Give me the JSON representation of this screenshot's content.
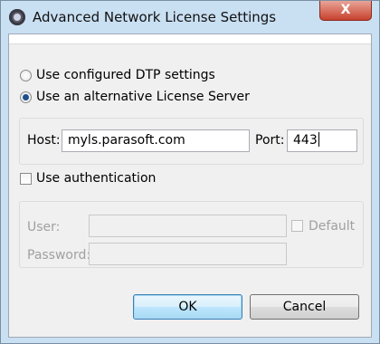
{
  "window": {
    "title": "Advanced Network License Settings",
    "close_glyph": "X"
  },
  "mode": {
    "option_dtp": "Use configured DTP settings",
    "option_alt_server": "Use an alternative License Server",
    "selected": "option_alt_server"
  },
  "server": {
    "host_label": "Host:",
    "host_value": "myls.parasoft.com",
    "port_label": "Port:",
    "port_value": "443"
  },
  "auth": {
    "use_auth_label": "Use authentication",
    "use_auth_checked": false,
    "user_label": "User:",
    "user_value": "",
    "default_label": "Default",
    "default_checked": false,
    "password_label": "Password:",
    "password_value": ""
  },
  "buttons": {
    "ok": "OK",
    "cancel": "Cancel"
  },
  "icons": {
    "app": "parasoft-gear-icon",
    "close": "close-icon"
  },
  "colors": {
    "titlebar": "#c9dff2",
    "close_button": "#c7412f",
    "dialog_bg": "#f0f0f0",
    "default_button_border": "#3c7fb1"
  }
}
